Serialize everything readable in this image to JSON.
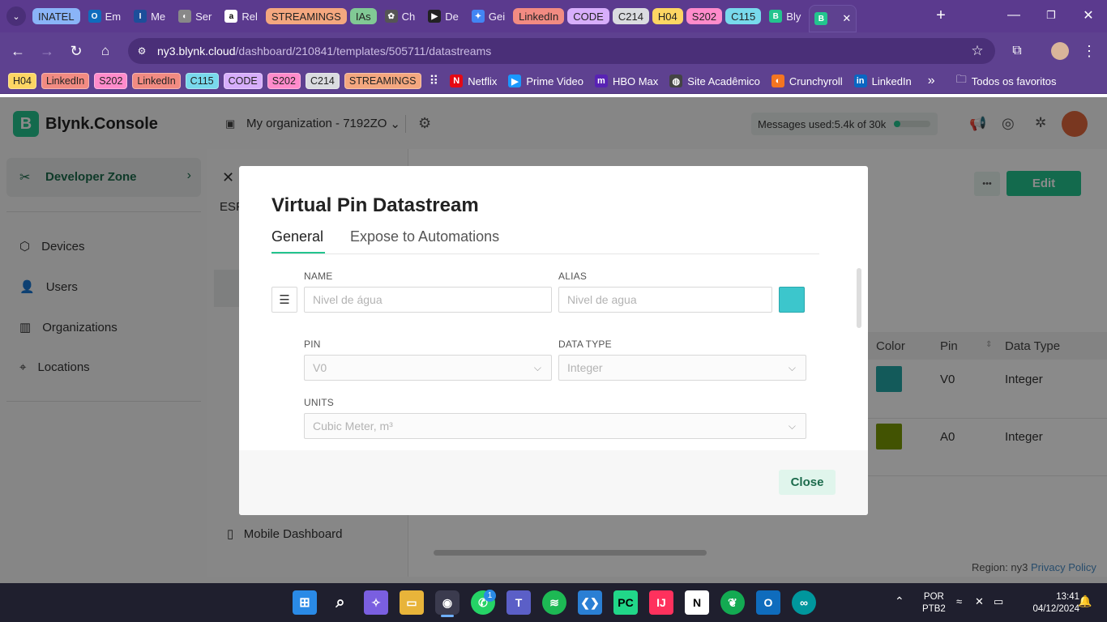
{
  "browser": {
    "tabs": [
      {
        "type": "group",
        "label": "INATEL",
        "color": "#8ab4f8"
      },
      {
        "type": "tab",
        "label": "Em",
        "fav": "O",
        "favColor": "#0f6cbd"
      },
      {
        "type": "tab",
        "label": "Me",
        "fav": "I",
        "favColor": "#1d4e9a"
      },
      {
        "type": "tab",
        "label": "Ser",
        "fav": "◐",
        "favColor": "#888"
      },
      {
        "type": "tab",
        "label": "Rel",
        "fav": "a",
        "favColor": "#fff"
      },
      {
        "type": "group",
        "label": "STREAMINGS",
        "color": "#f4a77f"
      },
      {
        "type": "group",
        "label": "IAs",
        "color": "#81c995"
      },
      {
        "type": "tab",
        "label": "Ch",
        "fav": "✿",
        "favColor": "#555"
      },
      {
        "type": "tab",
        "label": "De",
        "fav": "▶",
        "favColor": "#222"
      },
      {
        "type": "tab",
        "label": "Gei",
        "fav": "✦",
        "favColor": "#4285f4"
      },
      {
        "type": "group",
        "label": "LinkedIn",
        "color": "#f28b82"
      },
      {
        "type": "group",
        "label": "CODE",
        "color": "#d7aefb"
      },
      {
        "type": "group",
        "label": "C214",
        "color": "#dadce0"
      },
      {
        "type": "group",
        "label": "H04",
        "color": "#fdd663"
      },
      {
        "type": "group",
        "label": "S202",
        "color": "#ff8bcb"
      },
      {
        "type": "group",
        "label": "C115",
        "color": "#78d9ec"
      },
      {
        "type": "tab",
        "label": "Bly",
        "fav": "B",
        "favColor": "#23c48e"
      }
    ],
    "url_host": "ny3.blynk.cloud",
    "url_path": "/dashboard/210841/templates/505711/datastreams",
    "bookmark_groups": [
      {
        "label": "H04",
        "color": "#fdd663"
      },
      {
        "label": "LinkedIn",
        "color": "#f28b82"
      },
      {
        "label": "S202",
        "color": "#ff8bcb"
      },
      {
        "label": "LinkedIn",
        "color": "#f28b82"
      },
      {
        "label": "C115",
        "color": "#78d9ec"
      },
      {
        "label": "CODE",
        "color": "#d7aefb"
      },
      {
        "label": "S202",
        "color": "#ff8bcb"
      },
      {
        "label": "C214",
        "color": "#dadce0"
      },
      {
        "label": "STREAMINGS",
        "color": "#f4a77f"
      }
    ],
    "bookmarks": [
      "Netflix",
      "Prime Video",
      "HBO Max",
      "Site Acadêmico",
      "Crunchyroll",
      "LinkedIn"
    ],
    "all_bookmarks": "Todos os favoritos"
  },
  "app": {
    "logo": "Blynk.Console",
    "org": "My organization - 7192ZO",
    "messages_label": "Messages used: ",
    "messages_value": "5.4k of 30k",
    "messages_fraction": 0.18,
    "dev_zone": "Developer Zone",
    "nav": [
      "Devices",
      "Users",
      "Organizations",
      "Locations"
    ],
    "template_name": "ESP",
    "mobile_dashboard": "Mobile Dashboard",
    "edit": "Edit",
    "more": "•••",
    "table": {
      "headers": [
        "Color",
        "Pin",
        "Data Type"
      ],
      "rows": [
        {
          "color": "#23a6a6",
          "pin": "V0",
          "type": "Integer"
        },
        {
          "color": "#7a9a05",
          "pin": "A0",
          "type": "Integer"
        }
      ]
    },
    "region": "Region: ny3",
    "privacy": "Privacy Policy"
  },
  "modal": {
    "title": "Virtual Pin Datastream",
    "tabs": [
      "General",
      "Expose to Automations"
    ],
    "name_label": "NAME",
    "name_placeholder": "Nivel de água",
    "alias_label": "ALIAS",
    "alias_placeholder": "Nivel de agua",
    "color": "#3cc6cc",
    "pin_label": "PIN",
    "pin_value": "V0",
    "type_label": "DATA TYPE",
    "type_value": "Integer",
    "units_label": "UNITS",
    "units_value": "Cubic Meter, m³",
    "close": "Close"
  },
  "taskbar": {
    "lang": "POR",
    "layout": "PTB2",
    "time": "13:41",
    "date": "04/12/2024",
    "whatsapp_badge": "1"
  }
}
